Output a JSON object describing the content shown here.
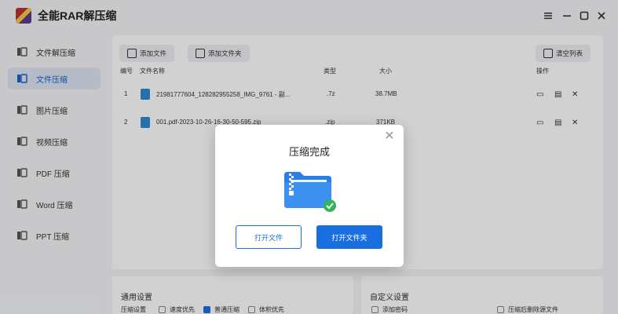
{
  "app": {
    "title": "全能RAR解压缩"
  },
  "window_controls": [
    "pin-icon",
    "minimize-icon",
    "maximize-icon",
    "close-icon"
  ],
  "sidebar": {
    "items": [
      {
        "label": "文件解压缩",
        "icon": "archive-extract-icon"
      },
      {
        "label": "文件压缩",
        "icon": "archive-compress-icon",
        "active": true
      },
      {
        "label": "图片压缩",
        "icon": "image-compress-icon"
      },
      {
        "label": "视频压缩",
        "icon": "video-compress-icon"
      },
      {
        "label": "PDF 压缩",
        "icon": "pdf-compress-icon"
      },
      {
        "label": "Word 压缩",
        "icon": "word-compress-icon"
      },
      {
        "label": "PPT 压缩",
        "icon": "ppt-compress-icon"
      }
    ]
  },
  "toolbar": {
    "add_file": "添加文件",
    "add_folder": "添加文件夹",
    "clear_list": "清空列表"
  },
  "table": {
    "headers": [
      "编号",
      "文件名称",
      "类型",
      "大小",
      "操作"
    ],
    "rows": [
      {
        "index": "1",
        "name": "21981777604_128282955258_IMG_9761 - 副...",
        "type": ".7z",
        "size": "38.7MB"
      },
      {
        "index": "2",
        "name": "001.pdf-2023-10-26-16-30-50-595.zip",
        "type": ".zip",
        "size": "371KB"
      }
    ]
  },
  "general_settings": {
    "title": "通用设置",
    "level_label": "压缩设置",
    "options": [
      {
        "label": "速度优先",
        "checked": false
      },
      {
        "label": "普通压缩",
        "checked": true
      },
      {
        "label": "体积优先",
        "checked": false
      }
    ]
  },
  "custom_settings": {
    "title": "自定义设置",
    "options": [
      {
        "label": "添加密码",
        "checked": false
      },
      {
        "label": "压缩后删除源文件",
        "checked": false
      }
    ]
  },
  "dialog": {
    "title": "压缩完成",
    "open_file": "打开文件",
    "open_folder": "打开文件夹"
  },
  "colors": {
    "accent": "#1a6fe0",
    "success": "#2fb55a",
    "folder": "#2a7ee6"
  }
}
